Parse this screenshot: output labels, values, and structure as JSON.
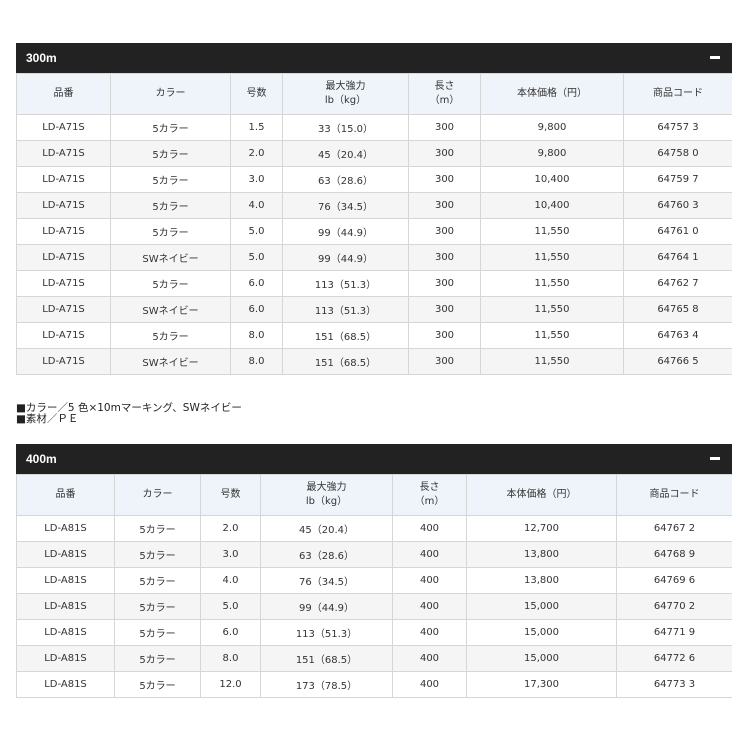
{
  "sections": [
    {
      "title": "300m",
      "toggle": "−",
      "headers": [
        "品番",
        "カラー",
        "号数",
        "最大強力",
        "lb（kg）",
        "長さ",
        "（m）",
        "本体価格（円）",
        "商品コード"
      ],
      "rows": [
        [
          "LD-A71S",
          "5カラー",
          "1.5",
          "33（15.0）",
          "300",
          "9,800",
          "64757 3"
        ],
        [
          "LD-A71S",
          "5カラー",
          "2.0",
          "45（20.4）",
          "300",
          "9,800",
          "64758 0"
        ],
        [
          "LD-A71S",
          "5カラー",
          "3.0",
          "63（28.6）",
          "300",
          "10,400",
          "64759 7"
        ],
        [
          "LD-A71S",
          "5カラー",
          "4.0",
          "76（34.5）",
          "300",
          "10,400",
          "64760 3"
        ],
        [
          "LD-A71S",
          "5カラー",
          "5.0",
          "99（44.9）",
          "300",
          "11,550",
          "64761 0"
        ],
        [
          "LD-A71S",
          "SWネイビー",
          "5.0",
          "99（44.9）",
          "300",
          "11,550",
          "64764 1"
        ],
        [
          "LD-A71S",
          "5カラー",
          "6.0",
          "113（51.3）",
          "300",
          "11,550",
          "64762 7"
        ],
        [
          "LD-A71S",
          "SWネイビー",
          "6.0",
          "113（51.3）",
          "300",
          "11,550",
          "64765 8"
        ],
        [
          "LD-A71S",
          "5カラー",
          "8.0",
          "151（68.5）",
          "300",
          "11,550",
          "64763 4"
        ],
        [
          "LD-A71S",
          "SWネイビー",
          "8.0",
          "151（68.5）",
          "300",
          "11,550",
          "64766 5"
        ]
      ]
    },
    {
      "title": "400m",
      "toggle": "−",
      "headers": [
        "品番",
        "カラー",
        "号数",
        "最大強力",
        "lb（kg）",
        "長さ",
        "（m）",
        "本体価格（円）",
        "商品コード"
      ],
      "rows": [
        [
          "LD-A81S",
          "5カラー",
          "2.0",
          "45（20.4）",
          "400",
          "12,700",
          "64767 2"
        ],
        [
          "LD-A81S",
          "5カラー",
          "3.0",
          "63（28.6）",
          "400",
          "13,800",
          "64768 9"
        ],
        [
          "LD-A81S",
          "5カラー",
          "4.0",
          "76（34.5）",
          "400",
          "13,800",
          "64769 6"
        ],
        [
          "LD-A81S",
          "5カラー",
          "5.0",
          "99（44.9）",
          "400",
          "15,000",
          "64770 2"
        ],
        [
          "LD-A81S",
          "5カラー",
          "6.0",
          "113（51.3）",
          "400",
          "15,000",
          "64771 9"
        ],
        [
          "LD-A81S",
          "5カラー",
          "8.0",
          "151（68.5）",
          "400",
          "15,000",
          "64772 6"
        ],
        [
          "LD-A81S",
          "5カラー",
          "12.0",
          "173（78.5）",
          "400",
          "17,300",
          "64773 3"
        ]
      ]
    }
  ],
  "notes": [
    "■カラー／5 色×10mマーキング、SWネイビー",
    "■素材／ＰＥ"
  ]
}
